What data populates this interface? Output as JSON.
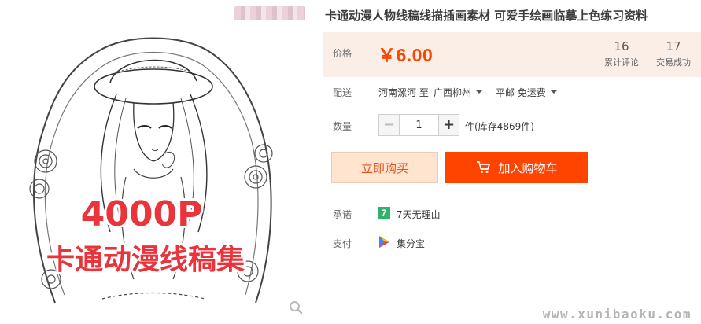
{
  "product": {
    "title": "卡通动漫人物线稿线描插画素材 可爱手绘画临摹上色练习资料",
    "image": {
      "promo_line1": "4000P",
      "promo_line2": "卡通动漫线稿集"
    }
  },
  "price": {
    "label": "价格",
    "value": "￥6.00"
  },
  "stats": {
    "reviews_count": "16",
    "reviews_label": "累计评论",
    "trades_count": "17",
    "trades_label": "交易成功"
  },
  "shipping": {
    "label": "配送",
    "from_text": "河南漯河 至",
    "to_location": "广西柳州",
    "method": "平邮 免运费"
  },
  "quantity": {
    "label": "数量",
    "minus": "−",
    "plus": "+",
    "value": "1",
    "stock": "件(库存4869件)"
  },
  "actions": {
    "buy_now": "立即购买",
    "add_to_cart": "加入购物车"
  },
  "promise": {
    "label": "承诺",
    "icon_text": "7",
    "text": "7天无理由"
  },
  "payment": {
    "label": "支付",
    "text": "集分宝"
  },
  "watermark": "www.xunibaoku.com",
  "colors": {
    "accent": "#ff4400",
    "price_bg": "#fbeee7",
    "buy_now_bg": "#ffe4d0",
    "promise_green": "#2fb36a",
    "promo_text": "#e8343a"
  },
  "icons": {
    "zoom": "magnifier-icon",
    "cart": "cart-icon",
    "promise": "seven-day-badge-icon",
    "payment": "play-triangle-icon"
  }
}
